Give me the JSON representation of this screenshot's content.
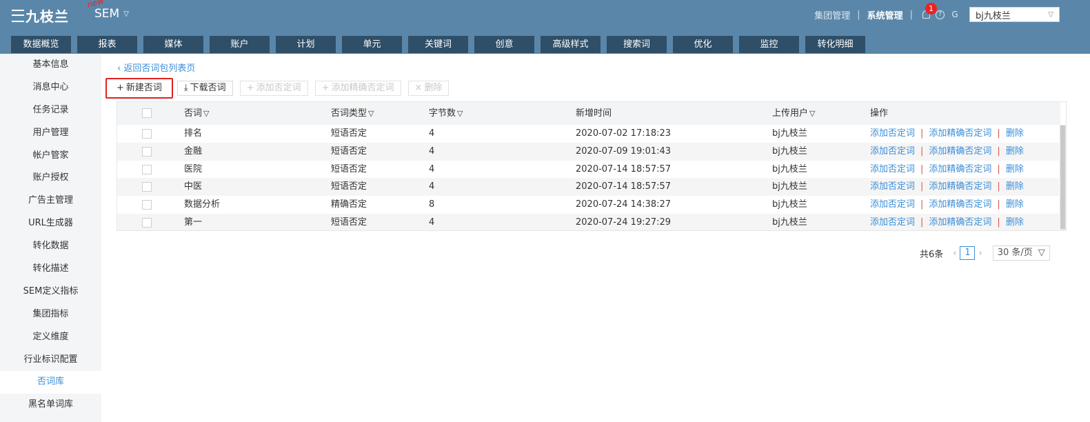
{
  "header": {
    "logo_text": "九枝兰",
    "new_tag": "new",
    "product": "SEM",
    "group_mgmt": "集团管理",
    "system_mgmt": "系统管理",
    "notif_count": "1",
    "account": "bj九枝兰"
  },
  "nav": [
    "数据概览",
    "报表",
    "媒体",
    "账户",
    "计划",
    "单元",
    "关键词",
    "创意",
    "高级样式",
    "搜索词",
    "优化",
    "监控",
    "转化明细"
  ],
  "sidebar": [
    "基本信息",
    "消息中心",
    "任务记录",
    "用户管理",
    "帐户管家",
    "账户授权",
    "广告主管理",
    "URL生成器",
    "转化数据",
    "转化描述",
    "SEM定义指标",
    "集团指标",
    "定义维度",
    "行业标识配置",
    "否词库",
    "黑名单词库"
  ],
  "sidebar_active_index": 14,
  "back_link": "返回否词包列表页",
  "toolbar": {
    "new": "新建否词",
    "download": "下载否词",
    "add_negative": "添加否定词",
    "add_exact_negative": "添加精确否定词",
    "delete": "删除"
  },
  "table": {
    "headers": {
      "word": "否词",
      "type": "否词类型",
      "bytes": "字节数",
      "time": "新增时间",
      "user": "上传用户",
      "ops": "操作"
    },
    "ops": {
      "add": "添加否定词",
      "add_exact": "添加精确否定词",
      "del": "删除"
    },
    "rows": [
      {
        "word": "排名",
        "type": "短语否定",
        "bytes": "4",
        "time": "2020-07-02 17:18:23",
        "user": "bj九枝兰"
      },
      {
        "word": "金融",
        "type": "短语否定",
        "bytes": "4",
        "time": "2020-07-09 19:01:43",
        "user": "bj九枝兰"
      },
      {
        "word": "医院",
        "type": "短语否定",
        "bytes": "4",
        "time": "2020-07-14 18:57:57",
        "user": "bj九枝兰"
      },
      {
        "word": "中医",
        "type": "短语否定",
        "bytes": "4",
        "time": "2020-07-14 18:57:57",
        "user": "bj九枝兰"
      },
      {
        "word": "数据分析",
        "type": "精确否定",
        "bytes": "8",
        "time": "2020-07-24 14:38:27",
        "user": "bj九枝兰"
      },
      {
        "word": "第一",
        "type": "短语否定",
        "bytes": "4",
        "time": "2020-07-24 19:27:29",
        "user": "bj九枝兰"
      }
    ]
  },
  "pager": {
    "total": "共6条",
    "page": "1",
    "page_size": "30 条/页"
  },
  "colors": {
    "header_bg": "#5a87a9",
    "tab_bg": "#2f4e68",
    "link": "#3b8ed8",
    "highlight": "#e02020"
  }
}
